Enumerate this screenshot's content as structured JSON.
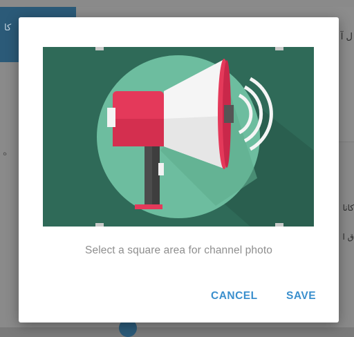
{
  "background": {
    "sidebar_tab_text": "کا",
    "header_text": "ل آ",
    "left_text": "ه",
    "right_text_1": "کانا",
    "right_text_2": "ق ا"
  },
  "dialog": {
    "hint": "Select a square area for channel photo",
    "cancel_label": "CANCEL",
    "save_label": "SAVE",
    "image_icon": "megaphone-icon"
  },
  "colors": {
    "accent": "#3a8fcd",
    "image_background": "#2f6a58",
    "circle": "#6dbd9f",
    "megaphone_red": "#e4395a"
  }
}
